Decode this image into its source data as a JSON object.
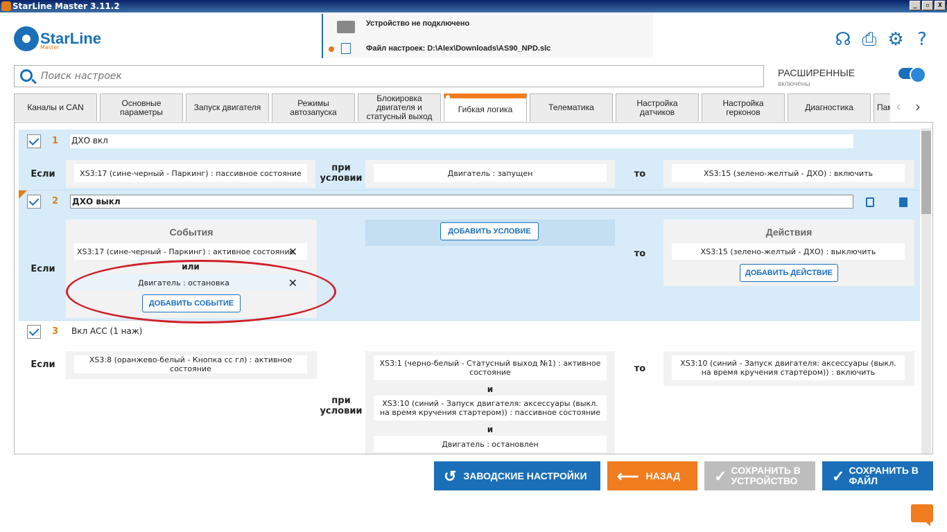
{
  "window": {
    "title": "StarLine Master 3.11.2",
    "controls": [
      "_",
      "▫",
      "X"
    ]
  },
  "logo": {
    "name": "StarLine",
    "sub": "Master"
  },
  "device": {
    "status": "Устройство не подключено",
    "file": "Файл настроек: D:\\Alex\\Downloads\\AS90_NPD.slc"
  },
  "search": {
    "placeholder": "Поиск настроек"
  },
  "advanced": {
    "label": "РАСШИРЕННЫЕ",
    "state": "включены",
    "enabled": true
  },
  "tabs": [
    {
      "label": "Каналы и CAN"
    },
    {
      "label": "Основные параметры"
    },
    {
      "label": "Запуск двигателя"
    },
    {
      "label": "Режимы автозапуска"
    },
    {
      "label": "Блокировка двигателя и статусный выход"
    },
    {
      "label": "Гибкая логика",
      "active": true
    },
    {
      "label": "Телематика"
    },
    {
      "label": "Настройка датчиков"
    },
    {
      "label": "Настройка герконов"
    },
    {
      "label": "Диагностика"
    },
    {
      "label": "Пам"
    }
  ],
  "rules": {
    "r1": {
      "num": "1",
      "name": "ДХО вкл",
      "if": "Если",
      "cond_label": "при условии",
      "then": "то",
      "event": "XS3:17 (сине-черный - Паркинг) : пассивное состояние",
      "condition": "Двигатель : запущен",
      "action": "XS3:15 (зелено-желтый - ДХО) : включить"
    },
    "r2": {
      "num": "2",
      "name": "ДХО выкл",
      "if": "Если",
      "then": "то",
      "events_title": "События",
      "event1": "XS3:17 (сине-черный - Паркинг) : активное состояние",
      "or": "или",
      "event2": "Двигатель : остановка",
      "add_event": "ДОБАВИТЬ СОБЫТИЕ",
      "add_condition": "ДОБАВИТЬ УСЛОВИЕ",
      "actions_title": "Действия",
      "action": "XS3:15 (зелено-желтый - ДХО) : выключить",
      "add_action": "ДОБАВИТЬ ДЕЙСТВИЕ"
    },
    "r3": {
      "num": "3",
      "name": "Вкл ACC (1 наж)",
      "if": "Если",
      "cond_label": "при условии",
      "then": "то",
      "and": "и",
      "event": "XS3:8 (оранжево-белый - Кнопка сс гл) : активное состояние",
      "cond1": "XS3:1 (черно-белый - Статусный выход №1) : активное состояние",
      "cond2": "XS3:10 (синий - Запуск двигателя: аксессуары (выкл. на время кручения стартером)) : пассивное состояние",
      "cond3": "Двигатель : остановлен",
      "action": "XS3:10 (синий - Запуск двигателя: аксессуары (выкл. на время кручения стартером)) : включить"
    }
  },
  "footer": {
    "factory": "ЗАВОДСКИЕ НАСТРОЙКИ",
    "back": "НАЗАД",
    "save_device": "СОХРАНИТЬ В УСТРОЙСТВО",
    "save_file": "СОХРАНИТЬ В ФАЙЛ"
  },
  "colors": {
    "accent": "#1a6fb8",
    "orange": "#f07c1e",
    "highlight": "#d7ebf8",
    "annotation": "#d0202a"
  }
}
